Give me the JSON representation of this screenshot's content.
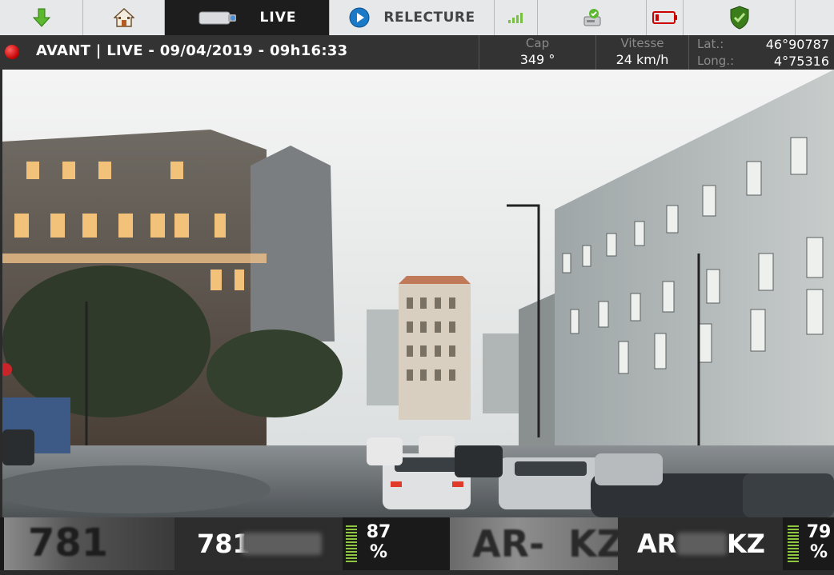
{
  "toolbar": {
    "buttons": [
      {
        "name": "download-button",
        "icon": "down-arrow-icon",
        "color": "#5cb82e"
      },
      {
        "name": "home-button",
        "icon": "home-icon"
      },
      {
        "name": "live-tab",
        "label": "LIVE",
        "icon": "camera-icon"
      },
      {
        "name": "replay-tab",
        "label": "RELECTURE",
        "icon": "play-icon",
        "color": "#1a7ac8"
      },
      {
        "name": "signal-indicator",
        "icon": "signal-icon",
        "color": "#7ac143"
      },
      {
        "name": "storage-indicator",
        "icon": "disk-check-icon"
      },
      {
        "name": "battery-indicator",
        "icon": "battery-icon",
        "color": "#cc0000"
      },
      {
        "name": "security-indicator",
        "icon": "shield-check-icon",
        "color": "#3a7d1a"
      }
    ]
  },
  "status": {
    "recording": true,
    "text": "AVANT | LIVE - 09/04/2019 - 09h16:33",
    "heading": {
      "label": "Cap",
      "value": "349 °"
    },
    "speed": {
      "label": "Vitesse",
      "value": "24 km/h"
    },
    "lat": {
      "label": "Lat.:",
      "value": "46°90787"
    },
    "lon": {
      "label": "Long.:",
      "value": "4°75316"
    }
  },
  "plates": [
    {
      "crop_text": "781",
      "text_visible": "781",
      "confidence": "87",
      "unit": "%"
    },
    {
      "crop_text": "AR-",
      "crop_text_end": "KZ",
      "text_start": "AR",
      "text_end": "KZ",
      "confidence": "79",
      "unit": "%"
    }
  ]
}
